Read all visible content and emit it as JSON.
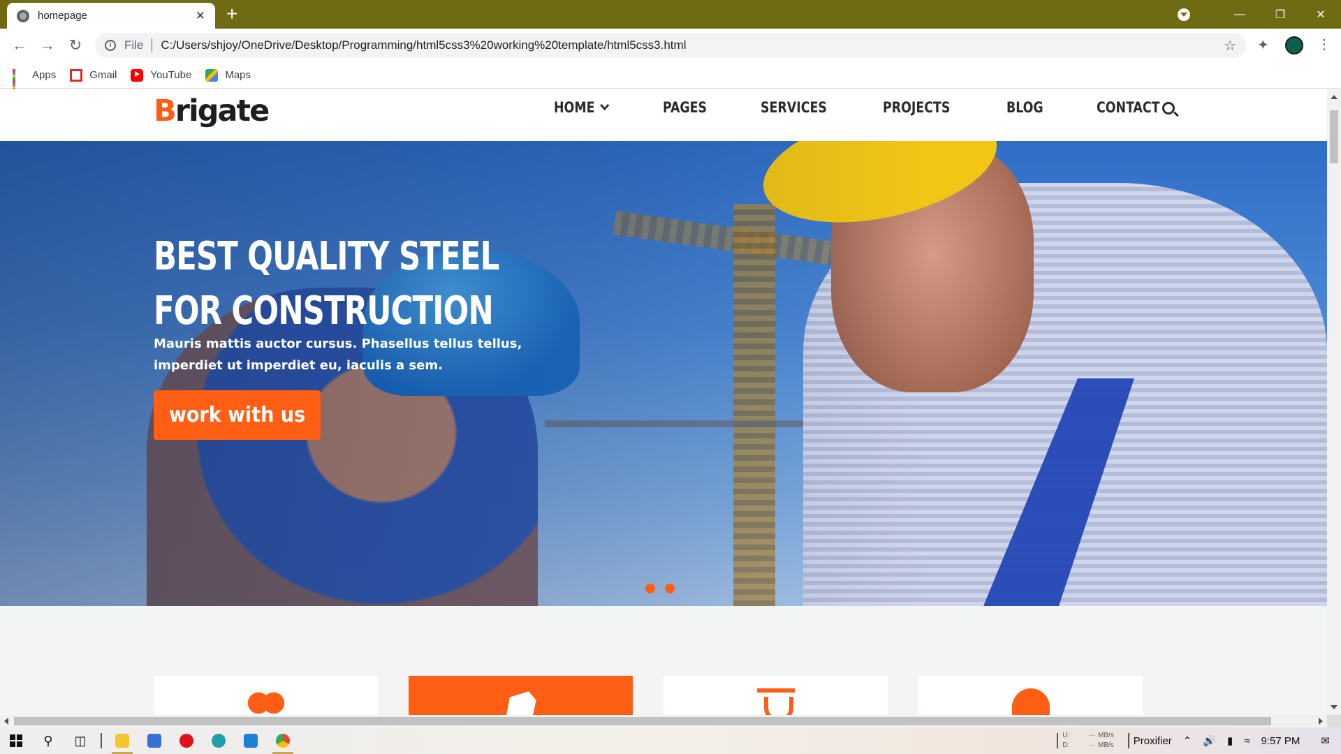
{
  "browser": {
    "tab_title": "homepage",
    "tab_close": "✕",
    "new_tab": "+",
    "scheme_label": "File",
    "url": "C:/Users/shjoy/OneDrive/Desktop/Programming/html5css3%20working%20template/html5css3.html",
    "bookmarks": [
      {
        "label": "Apps",
        "icon": "apps-grid-icon"
      },
      {
        "label": "Gmail",
        "icon": "gmail-icon"
      },
      {
        "label": "YouTube",
        "icon": "youtube-icon"
      },
      {
        "label": "Maps",
        "icon": "maps-icon"
      }
    ]
  },
  "site": {
    "logo_first": "B",
    "logo_rest": "rigate",
    "menu": [
      "HOME",
      "PAGES",
      "SERVICES",
      "PROJECTS",
      "BLOG",
      "CONTACT"
    ],
    "accent_color": "#ff5e14"
  },
  "hero": {
    "title": "BEST QUALITY STEEL FOR CONSTRUCTION",
    "text": "Mauris mattis auctor cursus. Phasellus tellus tellus, imperdiet ut imperdiet eu, iaculis a sem.",
    "button": "work with us"
  },
  "features": [
    {
      "icon": "handshake-icon",
      "active": false
    },
    {
      "icon": "hand-icon",
      "active": true
    },
    {
      "icon": "tool-icon",
      "active": false
    },
    {
      "icon": "helmet-icon",
      "active": false
    }
  ],
  "taskbar": {
    "tray_app": "Proxifier",
    "net_up": "U:",
    "net_down": "D:",
    "net_rate_up": "··· MB/s",
    "net_rate_down": "··· MB/s",
    "time": "9:57 PM"
  }
}
